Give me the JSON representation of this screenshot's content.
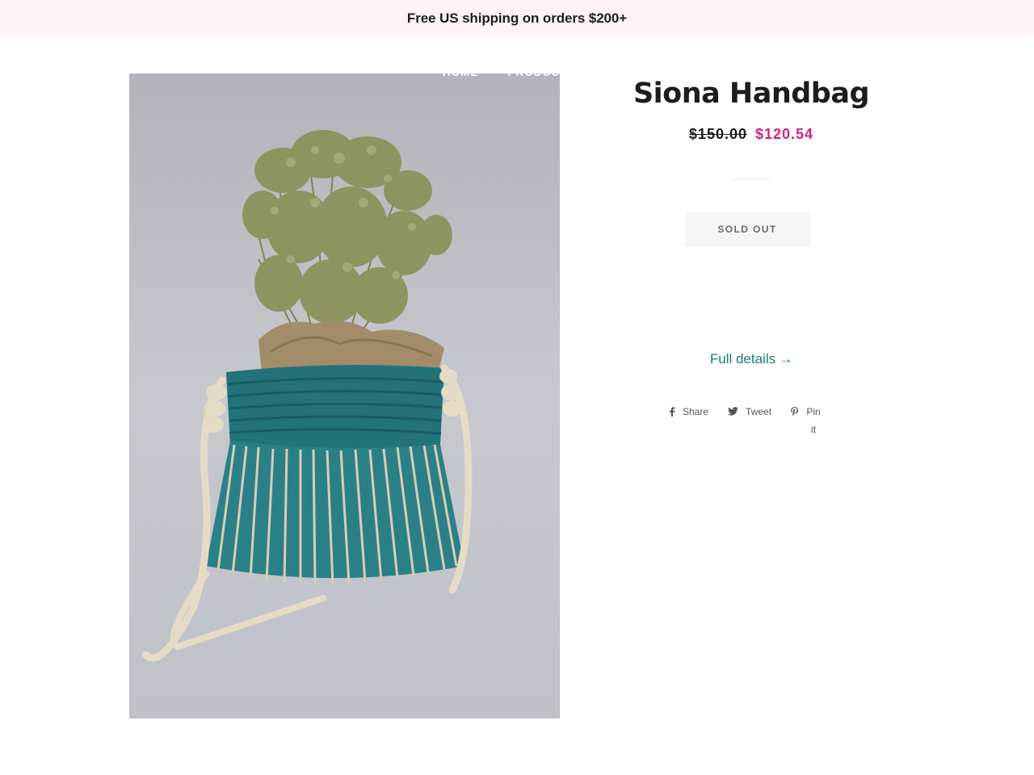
{
  "announcement": {
    "text": "Free US shipping on orders $200+"
  },
  "nav": {
    "items": [
      {
        "label": "Home"
      },
      {
        "label": "Products"
      }
    ]
  },
  "product": {
    "image_alt": "Siona Handbag",
    "title": "Siona Handbag",
    "compare_price": "$150.00",
    "sale_price": "$120.54",
    "sold_out_label": "Sold Out",
    "full_details_label": "Full details",
    "full_details_arrow": "→"
  },
  "share": {
    "facebook_label": "Share",
    "twitter_label": "Tweet",
    "pinterest_label": "Pin it"
  },
  "colors": {
    "announcement_bg": "#fff3f3",
    "sale_price": "#d1257a",
    "link": "#167a74"
  }
}
